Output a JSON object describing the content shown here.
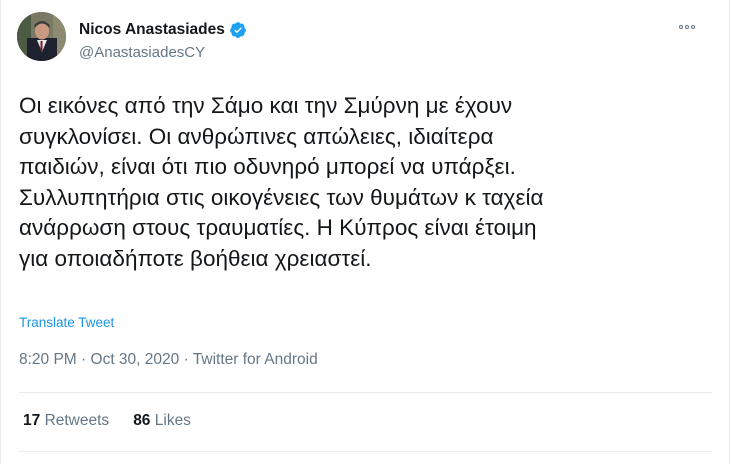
{
  "author": {
    "display_name": "Nicos Anastasiades",
    "handle": "@AnastasiadesCY",
    "verified": true
  },
  "tweet": {
    "lines": [
      "Οι εικόνες από την Σάμο και την Σμύρνη με έχουν",
      "συγκλονίσει. Οι ανθρώπινες απώλειες, ιδιαίτερα",
      "παιδιών, είναι ότι πιο οδυνηρό μπορεί να υπάρξει.",
      "Συλλυπητήρια στις οικογένειες των θυμάτων κ ταχεία",
      "ανάρρωση στους τραυματίες. Η Κύπρος είναι έτοιμη",
      "για οποιαδήποτε βοήθεια χρειαστεί."
    ],
    "translate_label": "Translate Tweet"
  },
  "meta": {
    "time": "8:20 PM",
    "date": "Oct 30, 2020",
    "source": "Twitter for Android"
  },
  "stats": {
    "retweets_count": "17",
    "retweets_label": "Retweets",
    "likes_count": "86",
    "likes_label": "Likes"
  },
  "colors": {
    "verified_badge": "#1da1f2",
    "link": "#1b95e0",
    "secondary_text": "#657786"
  },
  "icons": {
    "verified": "verified-badge-icon",
    "more": "more-options-icon"
  }
}
